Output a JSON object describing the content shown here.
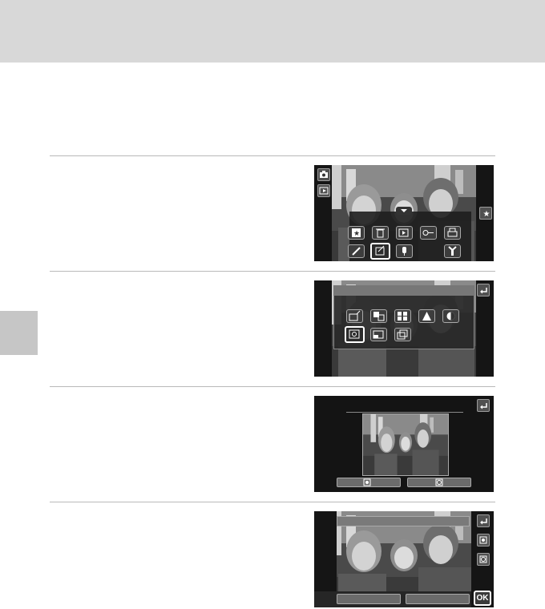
{
  "page": {
    "header_color": "#d8d8d8",
    "side_tab_color": "#c6c6c6"
  },
  "steps": [
    {
      "name": "step-1",
      "screen": "playback-menu",
      "icons_row1": [
        "favorites-icon",
        "delete-icon",
        "slideshow-icon",
        "protect-icon",
        "print-order-icon"
      ],
      "icons_row2": [
        "paint-icon",
        "retouch-icon",
        "voice-memo-icon",
        "",
        "setup-icon"
      ],
      "selected_icon": "retouch-icon",
      "left_icons": [
        "camera-mode-icon",
        "playback-mode-icon"
      ],
      "right_icons": [
        "favorites-star-icon"
      ]
    },
    {
      "name": "step-2",
      "screen": "retouch-menu",
      "icons_row1": [
        "quick-retouch-icon",
        "d-lighting-icon",
        "skin-softening-icon",
        "filter-effects-icon",
        "small-picture-icon"
      ],
      "icons_row2": [
        "glamour-retouch-icon",
        "crop-icon",
        "straighten-icon"
      ],
      "selected_icon": "glamour-retouch-icon",
      "right_icons": [
        "back-icon"
      ]
    },
    {
      "name": "step-3",
      "screen": "face-select",
      "bottom_buttons": [
        "slim-face-button",
        "enlarge-eyes-button"
      ],
      "right_icons": [
        "back-icon"
      ]
    },
    {
      "name": "step-4",
      "screen": "glamour-adjust",
      "right_icons": [
        "back-icon",
        "face-slim-icon",
        "eye-enlarge-icon"
      ],
      "ok_label": "OK"
    }
  ]
}
